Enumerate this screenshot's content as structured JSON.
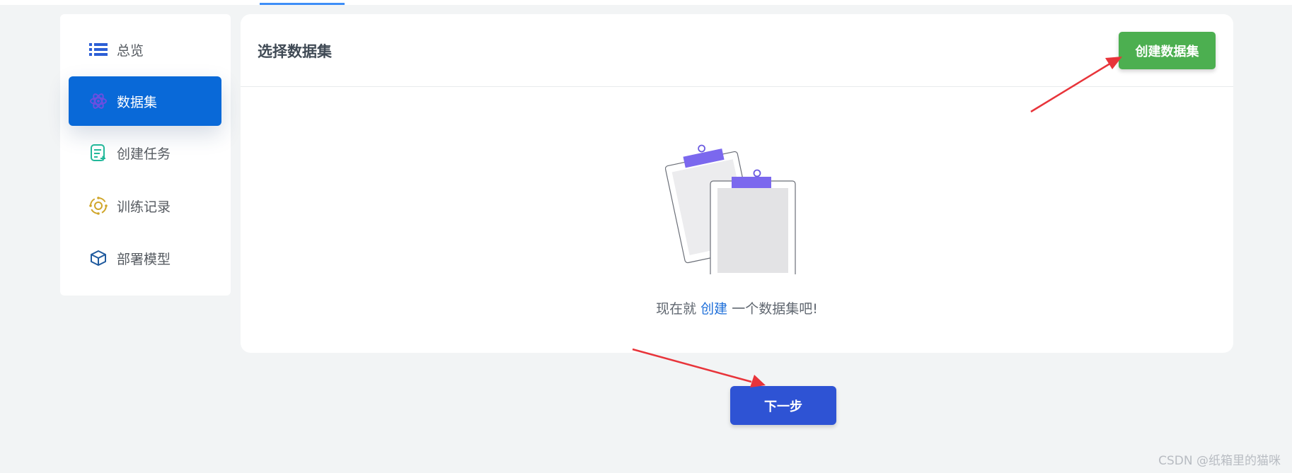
{
  "sidebar": {
    "items": [
      {
        "label": "总览",
        "icon": "list-icon"
      },
      {
        "label": "数据集",
        "icon": "dataset-icon",
        "active": true
      },
      {
        "label": "创建任务",
        "icon": "task-create-icon"
      },
      {
        "label": "训练记录",
        "icon": "training-record-icon"
      },
      {
        "label": "部署模型",
        "icon": "cube-icon"
      }
    ]
  },
  "card": {
    "title": "选择数据集",
    "create_button": "创建数据集",
    "empty": {
      "prefix": "现在就 ",
      "link": "创建",
      "suffix": " 一个数据集吧!"
    }
  },
  "next_button": "下一步",
  "watermark": "CSDN @纸箱里的猫咪",
  "colors": {
    "primary_active": "#0969d8",
    "create_button": "#4caf50",
    "next_button": "#2e53d4",
    "annotation_arrow": "#e8343a"
  }
}
